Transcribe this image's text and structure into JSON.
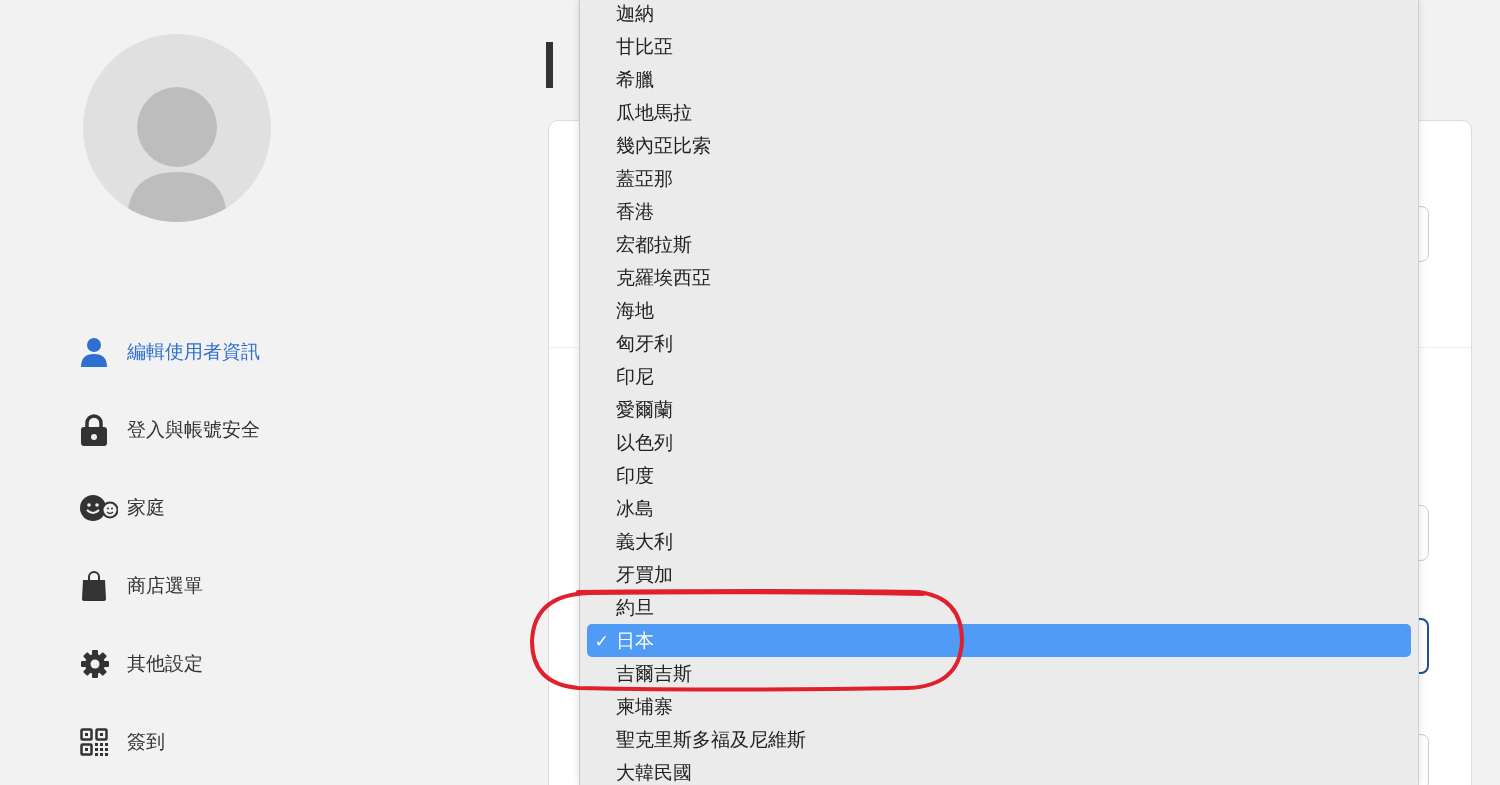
{
  "sidebar": {
    "items": [
      {
        "label": "編輯使用者資訊",
        "selected": true
      },
      {
        "label": "登入與帳號安全",
        "selected": false
      },
      {
        "label": "家庭",
        "selected": false
      },
      {
        "label": "商店選單",
        "selected": false
      },
      {
        "label": "其他設定",
        "selected": false
      },
      {
        "label": "簽到",
        "selected": false
      }
    ]
  },
  "form": {
    "fields": [
      {
        "focused": false
      },
      {
        "focused": false
      },
      {
        "focused": true
      },
      {
        "focused": false
      }
    ]
  },
  "country_dropdown": {
    "options": [
      {
        "label": "迦納",
        "selected": false
      },
      {
        "label": "甘比亞",
        "selected": false
      },
      {
        "label": "希臘",
        "selected": false
      },
      {
        "label": "瓜地馬拉",
        "selected": false
      },
      {
        "label": "幾內亞比索",
        "selected": false
      },
      {
        "label": "蓋亞那",
        "selected": false
      },
      {
        "label": "香港",
        "selected": false
      },
      {
        "label": "宏都拉斯",
        "selected": false
      },
      {
        "label": "克羅埃西亞",
        "selected": false
      },
      {
        "label": "海地",
        "selected": false
      },
      {
        "label": "匈牙利",
        "selected": false
      },
      {
        "label": "印尼",
        "selected": false
      },
      {
        "label": "愛爾蘭",
        "selected": false
      },
      {
        "label": "以色列",
        "selected": false
      },
      {
        "label": "印度",
        "selected": false
      },
      {
        "label": "冰島",
        "selected": false
      },
      {
        "label": "義大利",
        "selected": false
      },
      {
        "label": "牙買加",
        "selected": false
      },
      {
        "label": "約旦",
        "selected": false
      },
      {
        "label": "日本",
        "selected": true
      },
      {
        "label": "吉爾吉斯",
        "selected": false
      },
      {
        "label": "柬埔寨",
        "selected": false
      },
      {
        "label": "聖克里斯多福及尼維斯",
        "selected": false
      },
      {
        "label": "大韓民國",
        "selected": false
      }
    ],
    "check_mark": "✓"
  }
}
